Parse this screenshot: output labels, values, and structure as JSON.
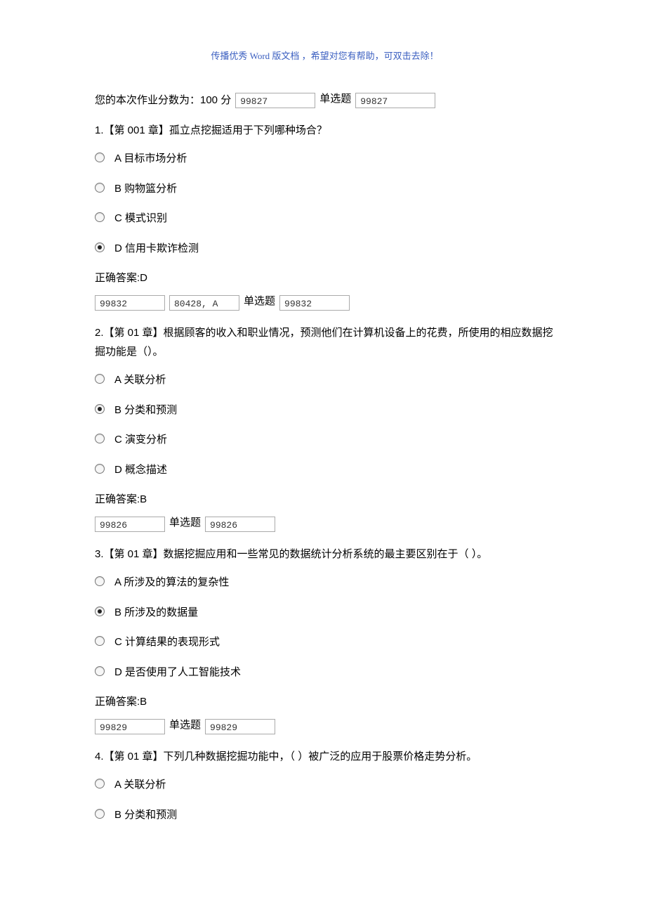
{
  "header_note": "传播优秀 Word 版文档 ，希望对您有帮助，可双击去除！",
  "score_prefix": "您的本次作业分数为：100 分",
  "section_label": "单选题",
  "box_vals": {
    "top1": "99827",
    "top2": "99827",
    "q1_a": "99832",
    "q1_b": "80428, A",
    "q1_c": "99832",
    "q2_a": "99826",
    "q2_b": "99826",
    "q3_a": "99829",
    "q3_b": "99829"
  },
  "q1": {
    "text": "1.【第 001 章】孤立点挖掘适用于下列哪种场合？",
    "A": "A  目标市场分析",
    "B": "B  购物篮分析",
    "C": "C  模式识别",
    "D": "D  信用卡欺诈检测",
    "answer": "正确答案:D"
  },
  "q2": {
    "text": "2.【第 01 章】根据顾客的收入和职业情况，预测他们在计算机设备上的花费，所使用的相应数据挖掘功能是（）。",
    "A": "A  关联分析",
    "B": "B  分类和预测",
    "C": "C  演变分析",
    "D": "D  概念描述",
    "answer": "正确答案:B"
  },
  "q3": {
    "text": "3.【第 01 章】数据挖掘应用和一些常见的数据统计分析系统的最主要区别在于（  ）。",
    "A": "A  所涉及的算法的复杂性",
    "B": "B  所涉及的数据量",
    "C": "C  计算结果的表现形式",
    "D": "D  是否使用了人工智能技术",
    "answer": "正确答案:B"
  },
  "q4": {
    "text": "4.【第 01 章】下列几种数据挖掘功能中，（   ）被广泛的应用于股票价格走势分析。",
    "A": "A  关联分析",
    "B": "B  分类和预测"
  }
}
